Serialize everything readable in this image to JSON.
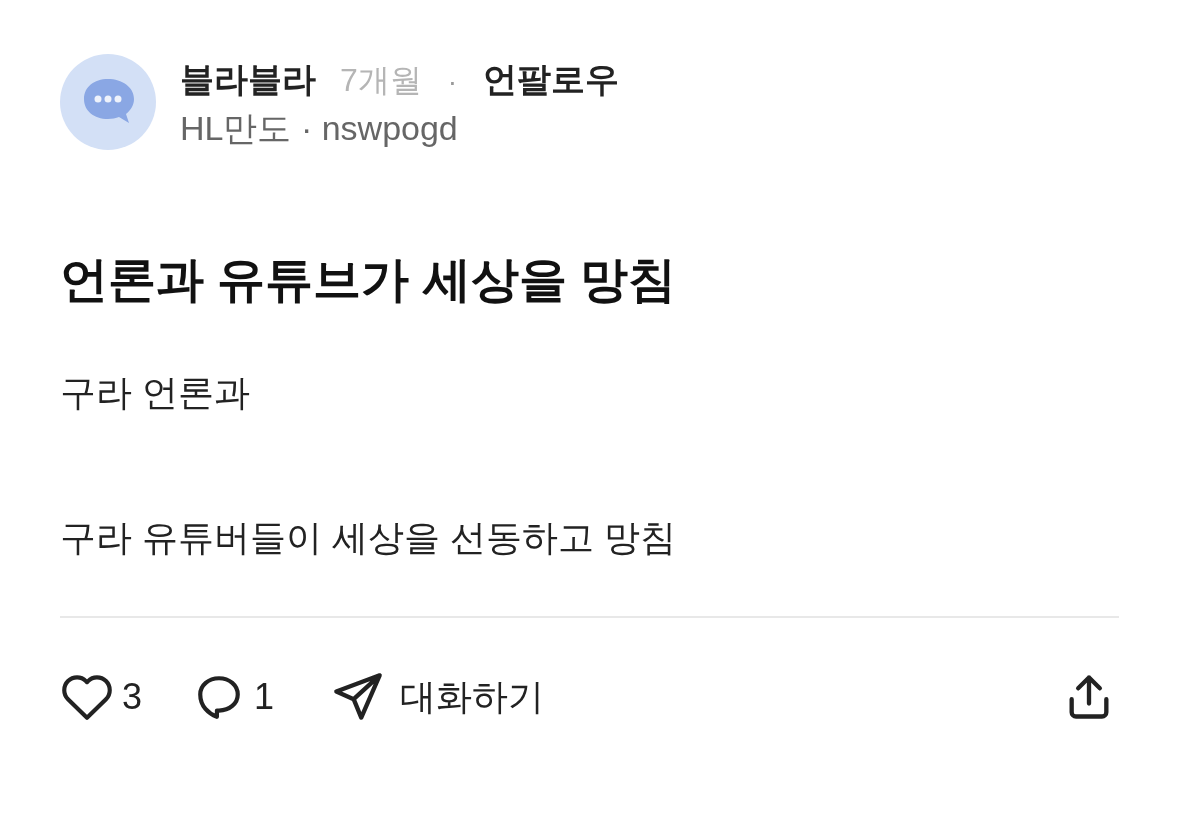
{
  "post": {
    "author": "블라블라",
    "time": "7개월",
    "separator": "·",
    "follow": "언팔로우",
    "company": "HL만도 · nswpogd",
    "title": "언론과 유튜브가 세상을 망침",
    "body": [
      "구라 언론과",
      "구라 유튜버들이 세상을 선동하고 망침"
    ],
    "actions": {
      "likes": "3",
      "comments": "1",
      "chat": "대화하기"
    }
  }
}
